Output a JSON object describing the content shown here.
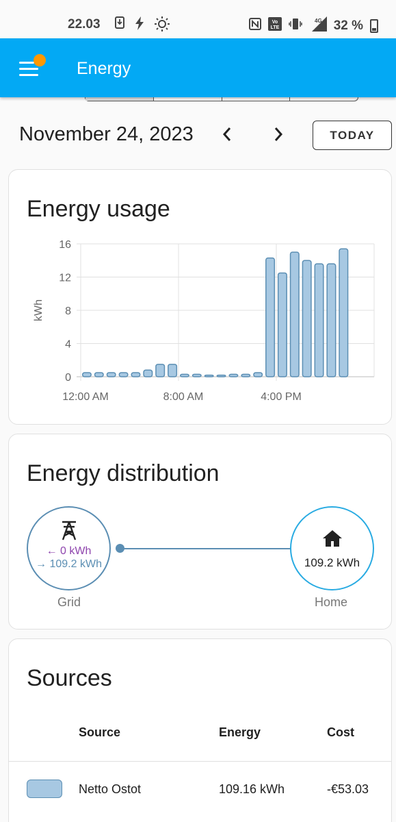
{
  "status_bar": {
    "time": "22.03",
    "battery": "32 %",
    "icons_left": [
      "download-icon",
      "flash-icon",
      "brightness-icon"
    ],
    "icons_right": [
      "nfc-icon",
      "volte-icon",
      "vibrate-icon",
      "signal-4g-icon",
      "battery-icon"
    ]
  },
  "app_bar": {
    "title": "Energy",
    "menu_icon": "menu-icon",
    "notification_dot_color": "#ff9800",
    "color": "#03a9f4"
  },
  "period_selector": {
    "active_index": 0,
    "count": 4
  },
  "date_nav": {
    "date": "November 24, 2023",
    "prev": "‹",
    "next": "›",
    "today_label": "TODAY"
  },
  "energy_usage": {
    "title": "Energy usage"
  },
  "chart_data": {
    "type": "bar",
    "title": "Energy usage",
    "ylabel": "kWh",
    "xlabel": "",
    "ylim": [
      0,
      16
    ],
    "yticks": [
      "0",
      "4",
      "8",
      "12",
      "16"
    ],
    "xticks": [
      {
        "label": "12:00 AM",
        "index": 0
      },
      {
        "label": "8:00 AM",
        "index": 8
      },
      {
        "label": "4:00 PM",
        "index": 16
      }
    ],
    "grid": true,
    "bar_color": "#a7c8e2",
    "bar_stroke": "#5b8eb3",
    "series": [
      {
        "values": [
          0.5,
          0.5,
          0.5,
          0.5,
          0.5,
          0.8,
          1.5,
          1.5,
          0.3,
          0.3,
          0.2,
          0.2,
          0.3,
          0.3,
          0.5,
          14.3,
          12.5,
          15.0,
          14.0,
          13.6,
          13.6,
          15.4,
          0,
          0
        ]
      }
    ]
  },
  "energy_distribution": {
    "title": "Energy distribution",
    "grid": {
      "label": "Grid",
      "icon": "transmission-tower-icon",
      "returned": "← 0 kWh",
      "consumed": "→ 109.2 kWh"
    },
    "home": {
      "label": "Home",
      "icon": "home-icon",
      "value": "109.2 kWh"
    }
  },
  "sources": {
    "title": "Sources",
    "headers": {
      "source": "Source",
      "energy": "Energy",
      "cost": "Cost"
    },
    "rows": [
      {
        "color": "#a7c8e2",
        "source": "Netto Ostot",
        "energy": "109.16 kWh",
        "cost": "-€53.03"
      }
    ]
  }
}
